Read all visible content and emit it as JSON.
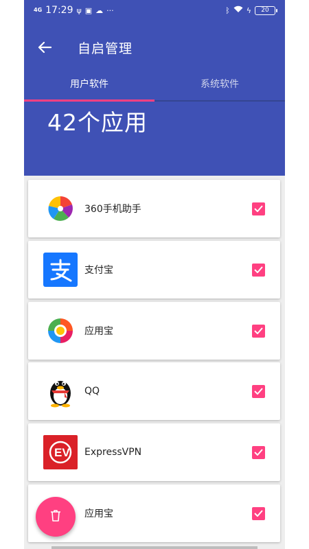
{
  "status_bar": {
    "signal": "4G",
    "time": "17:29",
    "battery": "20"
  },
  "app_bar": {
    "title": "自启管理"
  },
  "tabs": [
    {
      "label": "用户软件",
      "active": true
    },
    {
      "label": "系统软件",
      "active": false
    }
  ],
  "summary": {
    "count_text": "42个应用"
  },
  "apps": [
    {
      "name": "360手机助手",
      "icon": "360-assistant-icon",
      "checked": true
    },
    {
      "name": "支付宝",
      "icon": "alipay-icon",
      "checked": true
    },
    {
      "name": "应用宝",
      "icon": "yingyongbao-icon",
      "checked": true
    },
    {
      "name": "QQ",
      "icon": "qq-penguin-icon",
      "checked": true
    },
    {
      "name": "ExpressVPN",
      "icon": "expressvpn-icon",
      "checked": true
    },
    {
      "name": "应用宝",
      "icon": "yingyongbao-icon",
      "checked": true
    }
  ],
  "colors": {
    "primary": "#3f51b5",
    "accent": "#ff4081",
    "background": "#eeeeee"
  },
  "fab": {
    "icon": "trash-icon"
  }
}
